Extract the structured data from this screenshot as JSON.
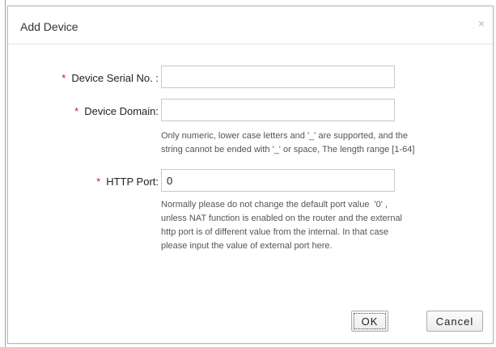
{
  "dialog": {
    "title": "Add Device",
    "close_glyph": "×"
  },
  "fields": [
    {
      "required_mark": "*",
      "label": "Device Serial No. :",
      "value": ""
    },
    {
      "required_mark": "*",
      "label": "Device Domain:",
      "value": "",
      "hint": [
        "Only numeric, lower case letters and '_' are supported, and the",
        "string cannot be ended with '_' or space, The length range [1-64]"
      ]
    },
    {
      "required_mark": "*",
      "label": "HTTP Port:",
      "value": "0",
      "hint": [
        "Normally please do not change the default port value  '0' ,",
        "unless NAT function is enabled on the router and the external",
        "http port is of different value from the internal. In that case",
        "please input the value of external port here."
      ]
    }
  ],
  "buttons": {
    "ok_label": "OK",
    "cancel_label": "Cancel"
  },
  "colors": {
    "required": "#d01818",
    "hint_text": "#555555"
  }
}
